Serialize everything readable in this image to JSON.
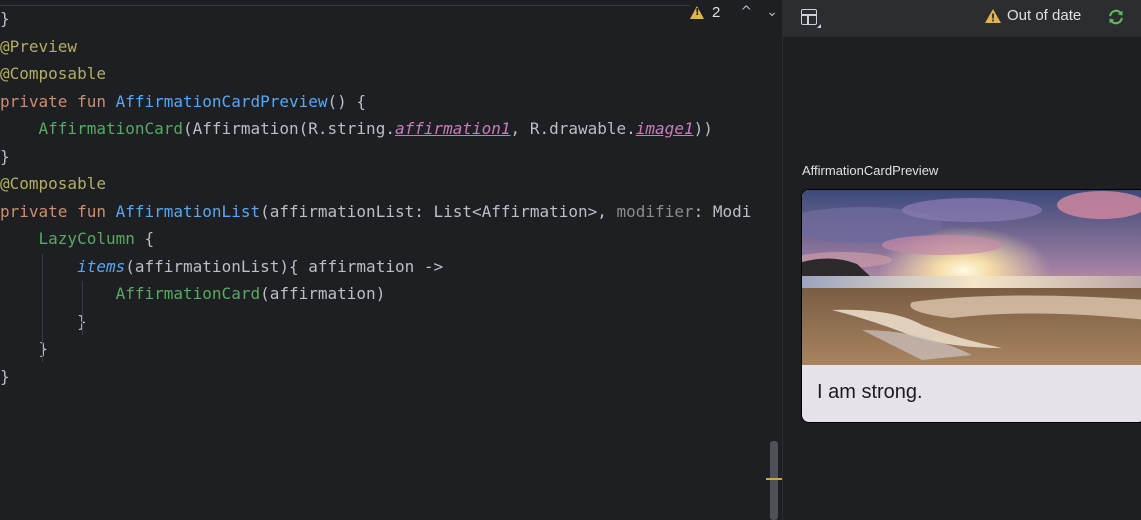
{
  "editor": {
    "inspections": {
      "warning_count": "2",
      "up_icon": "chevron-up-icon",
      "down_icon": "chevron-down-icon"
    },
    "code": {
      "l0_brace": "}",
      "l1_ann": "@Preview",
      "l2_ann": "@Composable",
      "l3_kw": "private fun ",
      "l3_fn": "AffirmationCardPreview",
      "l3_rest": "() {",
      "l4_indent": "    ",
      "l4_call": "AffirmationCard",
      "l4_a": "(Affirmation(R.string.",
      "l4_res1": "affirmation1",
      "l4_b": ", R.drawable.",
      "l4_res2": "image1",
      "l4_c": "))",
      "l5_brace": "}",
      "l6_ann": "@Composable",
      "l7_kw": "private fun ",
      "l7_fn": "AffirmationList",
      "l7_a": "(affirmationList: List<Affirmation>, ",
      "l7_param": "modifier",
      "l7_b": ": Modi",
      "l8_indent": "    ",
      "l8_call": "LazyColumn",
      "l8_rest": " {",
      "l9_indent": "        ",
      "l9_ext": "items",
      "l9_rest": "(affirmationList){ affirmation ->",
      "l10_indent": "            ",
      "l10_call": "AffirmationCard",
      "l10_rest": "(affirmation)",
      "l11_text": "        }",
      "l12_text": "    }",
      "l13_text": "}"
    }
  },
  "preview": {
    "toolbar": {
      "layout_icon": "layout-grid-icon",
      "status_text": "Out of date",
      "status_icon": "warning-icon",
      "refresh_icon": "refresh-icon"
    },
    "preview_name": "AffirmationCardPreview",
    "card": {
      "text": "I am strong."
    }
  },
  "colors": {
    "warning": "#e0b34c",
    "refresh": "#5fb85a",
    "annotation": "#b3ae60",
    "keyword": "#cf8e6d",
    "function": "#56a8f5",
    "call": "#57aa62"
  }
}
